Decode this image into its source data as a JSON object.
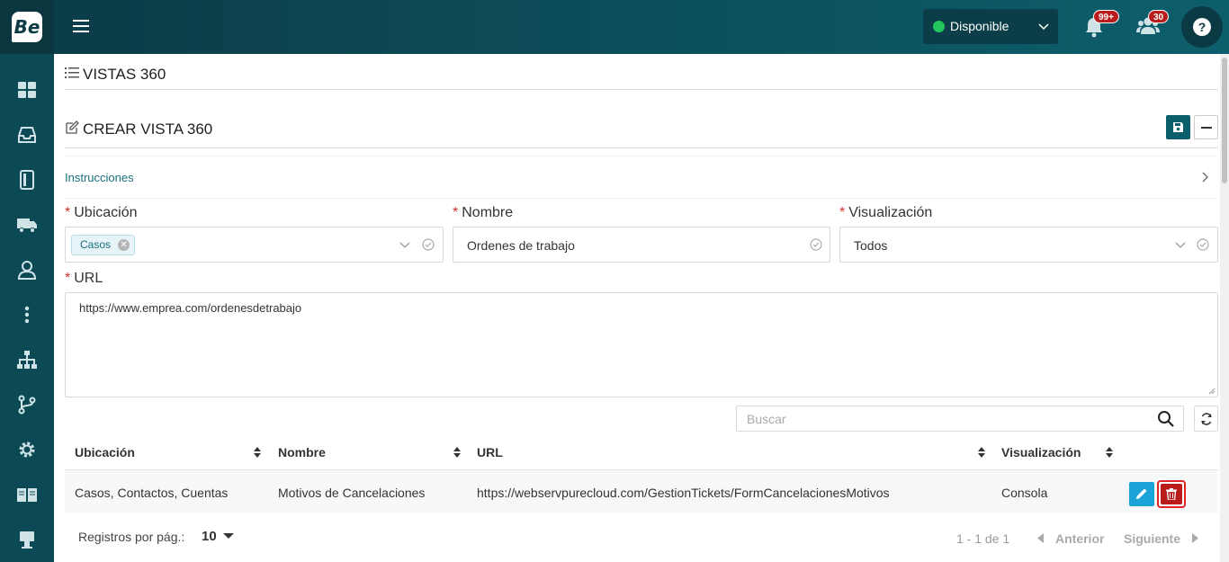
{
  "brand": {
    "logo_text": "Be"
  },
  "header": {
    "status_label": "Disponible",
    "status_color": "#22c55e",
    "notifications_badge": "99+",
    "users_badge": "30",
    "help_label": "?"
  },
  "sidebar": {
    "items": [
      "dashboard-icon",
      "inbox-icon",
      "contacts-book-icon",
      "truck-icon",
      "user-icon",
      "more-vertical-icon",
      "sitemap-icon",
      "branch-icon",
      "gear-icon",
      "book-open-icon",
      "kiosk-icon"
    ]
  },
  "page": {
    "section_title": "VISTAS 360",
    "form_title": "CREAR VISTA 360",
    "instructions_label": "Instrucciones"
  },
  "form": {
    "required_mark": "*",
    "ubicacion_label": "Ubicación",
    "ubicacion_tag": "Casos",
    "nombre_label": "Nombre",
    "nombre_value": "Ordenes de trabajo",
    "visualizacion_label": "Visualización",
    "visualizacion_value": "Todos",
    "url_label": "URL",
    "url_value": "https://www.emprea.com/ordenesdetrabajo"
  },
  "table": {
    "search_placeholder": "Buscar",
    "columns": [
      "Ubicación",
      "Nombre",
      "URL",
      "Visualización"
    ],
    "rows": [
      {
        "ubicacion": "Casos, Contactos, Cuentas",
        "nombre": "Motivos de Cancelaciones",
        "url": "https://webservpurecloud.com/GestionTickets/FormCancelacionesMotivos",
        "visualizacion": "Consola"
      }
    ],
    "footer": {
      "per_page_label": "Registros por pág.:",
      "per_page_value": "10",
      "page_info": "1 - 1 de 1",
      "prev_label": "Anterior",
      "next_label": "Siguiente"
    }
  },
  "colors": {
    "primary": "#0b5e6c",
    "accent": "#1a6f7e",
    "danger": "#b91c1c",
    "edit": "#1aa3d6"
  }
}
